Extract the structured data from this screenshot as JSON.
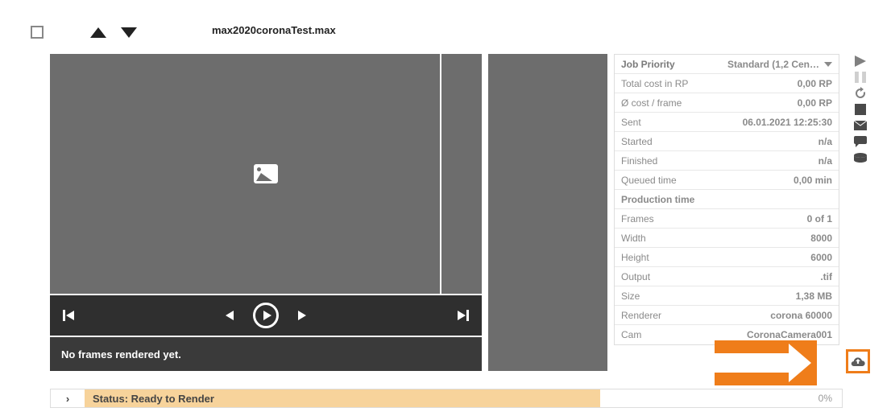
{
  "header": {
    "filename": "max2020coronaTest.max"
  },
  "player": {
    "no_frames_msg": "No frames rendered yet."
  },
  "info": {
    "rows": [
      {
        "label": "Job Priority",
        "value": "Standard (1,2 Cen…"
      },
      {
        "label": "Total cost in RP",
        "value": "0,00 RP"
      },
      {
        "label": "Ø cost / frame",
        "value": "0,00 RP"
      },
      {
        "label": "Sent",
        "value": "06.01.2021 12:25:30"
      },
      {
        "label": "Started",
        "value": "n/a"
      },
      {
        "label": "Finished",
        "value": "n/a"
      },
      {
        "label": "Queued time",
        "value": "0,00 min"
      },
      {
        "label": "Production time",
        "value": ""
      },
      {
        "label": "Frames",
        "value": "0 of 1"
      },
      {
        "label": "Width",
        "value": "8000"
      },
      {
        "label": "Height",
        "value": "6000"
      },
      {
        "label": "Output",
        "value": ".tif"
      },
      {
        "label": "Size",
        "value": "1,38 MB"
      },
      {
        "label": "Renderer",
        "value": "corona 60000"
      },
      {
        "label": "Cam",
        "value": "CoronaCamera001"
      }
    ]
  },
  "status": {
    "label": "Status: Ready to Render",
    "percent": "0%"
  }
}
